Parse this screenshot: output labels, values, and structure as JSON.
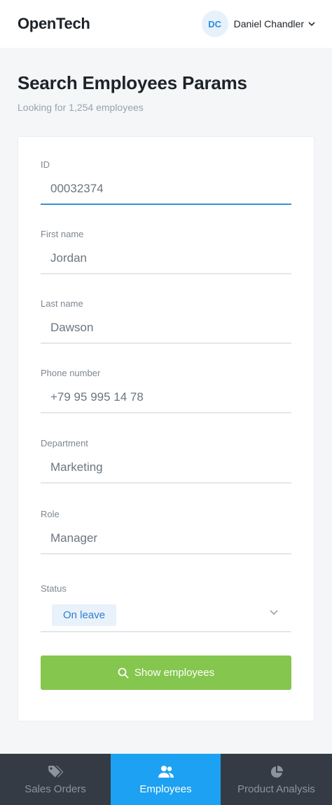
{
  "app": {
    "logo": "OpenTech"
  },
  "user": {
    "initials": "DC",
    "name": "Daniel Chandler"
  },
  "page": {
    "title": "Search Employees Params",
    "subtitle": "Looking for 1,254 employees"
  },
  "form": {
    "id": {
      "label": "ID",
      "value": "00032374"
    },
    "first_name": {
      "label": "First name",
      "value": "Jordan"
    },
    "last_name": {
      "label": "Last name",
      "value": "Dawson"
    },
    "phone": {
      "label": "Phone number",
      "value": "+79 95 995 14 78"
    },
    "department": {
      "label": "Department",
      "value": "Marketing"
    },
    "role": {
      "label": "Role",
      "value": "Manager"
    },
    "status": {
      "label": "Status",
      "value": "On leave"
    },
    "submit_label": "Show employees"
  },
  "nav": {
    "items": [
      {
        "label": "Sales Orders",
        "icon": "tag-icon"
      },
      {
        "label": "Employees",
        "icon": "users-icon"
      },
      {
        "label": "Product Analysis",
        "icon": "pie-chart-icon"
      }
    ],
    "active_index": 1
  },
  "colors": {
    "accent": "#1da1f2",
    "submit": "#85c64e",
    "nav_bg": "#353b44",
    "active_input": "#3a8ed8"
  }
}
